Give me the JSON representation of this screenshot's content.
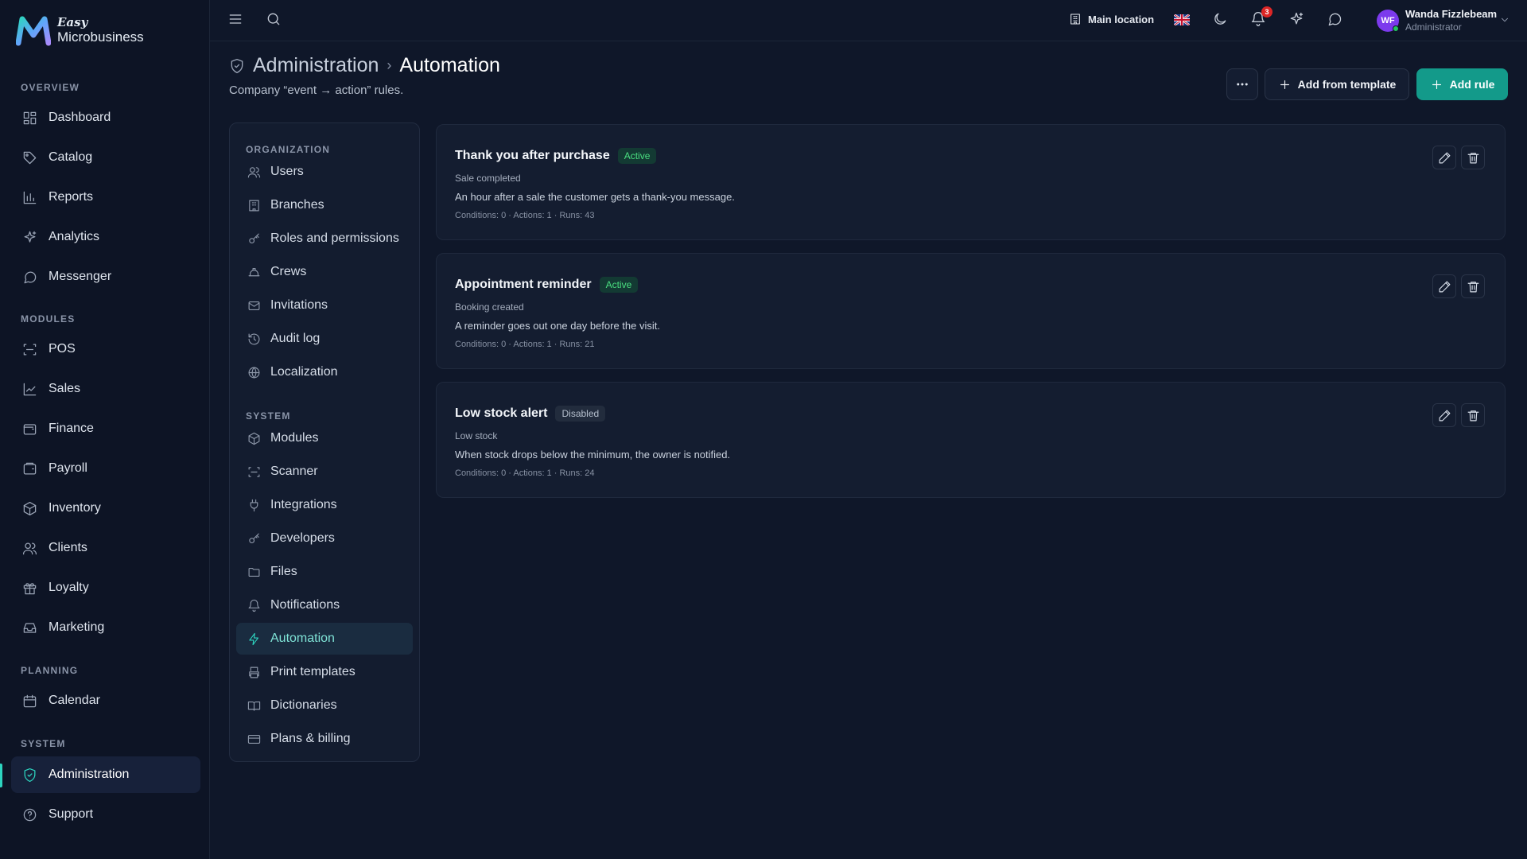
{
  "brand": {
    "easy": "Easy",
    "name": "Microbusiness"
  },
  "sidebar": {
    "sections": [
      "OVERVIEW",
      "MODULES",
      "PLANNING",
      "SYSTEM"
    ],
    "items": [
      {
        "label": "Dashboard",
        "icon": "dashboard-icon"
      },
      {
        "label": "Catalog",
        "icon": "tag-icon"
      },
      {
        "label": "Reports",
        "icon": "bar-chart-icon"
      },
      {
        "label": "Analytics",
        "icon": "sparkles-icon"
      },
      {
        "label": "Messenger",
        "icon": "chat-icon"
      },
      {
        "label": "POS",
        "icon": "scan-icon"
      },
      {
        "label": "Sales",
        "icon": "line-chart-icon"
      },
      {
        "label": "Finance",
        "icon": "wallet-icon"
      },
      {
        "label": "Payroll",
        "icon": "wallet-icon"
      },
      {
        "label": "Inventory",
        "icon": "box-icon"
      },
      {
        "label": "Clients",
        "icon": "users-icon"
      },
      {
        "label": "Loyalty",
        "icon": "gift-icon"
      },
      {
        "label": "Marketing",
        "icon": "inbox-icon"
      },
      {
        "label": "Calendar",
        "icon": "calendar-icon"
      },
      {
        "label": "Administration",
        "icon": "shield-icon"
      },
      {
        "label": "Support",
        "icon": "help-icon"
      }
    ],
    "active": "Administration"
  },
  "topbar": {
    "location": "Main location",
    "notifications_count": "3",
    "user": {
      "initials": "WF",
      "name": "Wanda Fizzlebeam",
      "role": "Administrator"
    }
  },
  "header": {
    "crumb_parent": "Administration",
    "crumb_current": "Automation",
    "subtitle": "Company “event → action” rules.",
    "add_template_label": "Add from template",
    "add_rule_label": "Add rule"
  },
  "settings_nav": {
    "org_title": "ORGANIZATION",
    "system_title": "SYSTEM",
    "org_items": [
      {
        "label": "Users",
        "icon": "users-icon"
      },
      {
        "label": "Branches",
        "icon": "building-icon"
      },
      {
        "label": "Roles and permissions",
        "icon": "key-icon"
      },
      {
        "label": "Crews",
        "icon": "hard-hat-icon"
      },
      {
        "label": "Invitations",
        "icon": "mail-icon"
      },
      {
        "label": "Audit log",
        "icon": "history-icon"
      },
      {
        "label": "Localization",
        "icon": "globe-icon"
      }
    ],
    "system_items": [
      {
        "label": "Modules",
        "icon": "box-icon"
      },
      {
        "label": "Scanner",
        "icon": "scan-icon"
      },
      {
        "label": "Integrations",
        "icon": "plug-icon"
      },
      {
        "label": "Developers",
        "icon": "key-icon"
      },
      {
        "label": "Files",
        "icon": "folder-icon"
      },
      {
        "label": "Notifications",
        "icon": "bell-icon"
      },
      {
        "label": "Automation",
        "icon": "bolt-icon"
      },
      {
        "label": "Print templates",
        "icon": "printer-icon"
      },
      {
        "label": "Dictionaries",
        "icon": "book-icon"
      },
      {
        "label": "Plans & billing",
        "icon": "card-icon"
      }
    ],
    "active": "Automation"
  },
  "rules": [
    {
      "name": "Thank you after purchase",
      "status": "Active",
      "trigger": "Sale completed",
      "description": "An hour after a sale the customer gets a thank-you message.",
      "meta": "Conditions: 0 · Actions: 1 · Runs: 43"
    },
    {
      "name": "Appointment reminder",
      "status": "Active",
      "trigger": "Booking created",
      "description": "A reminder goes out one day before the visit.",
      "meta": "Conditions: 0 · Actions: 1 · Runs: 21"
    },
    {
      "name": "Low stock alert",
      "status": "Disabled",
      "trigger": "Low stock",
      "description": "When stock drops below the minimum, the owner is notified.",
      "meta": "Conditions: 0 · Actions: 1 · Runs: 24"
    }
  ],
  "colors": {
    "accent": "#2dd4bf",
    "primary_button": "#139a8a",
    "background": "#0f1729",
    "active_badge": "#4ade80"
  }
}
